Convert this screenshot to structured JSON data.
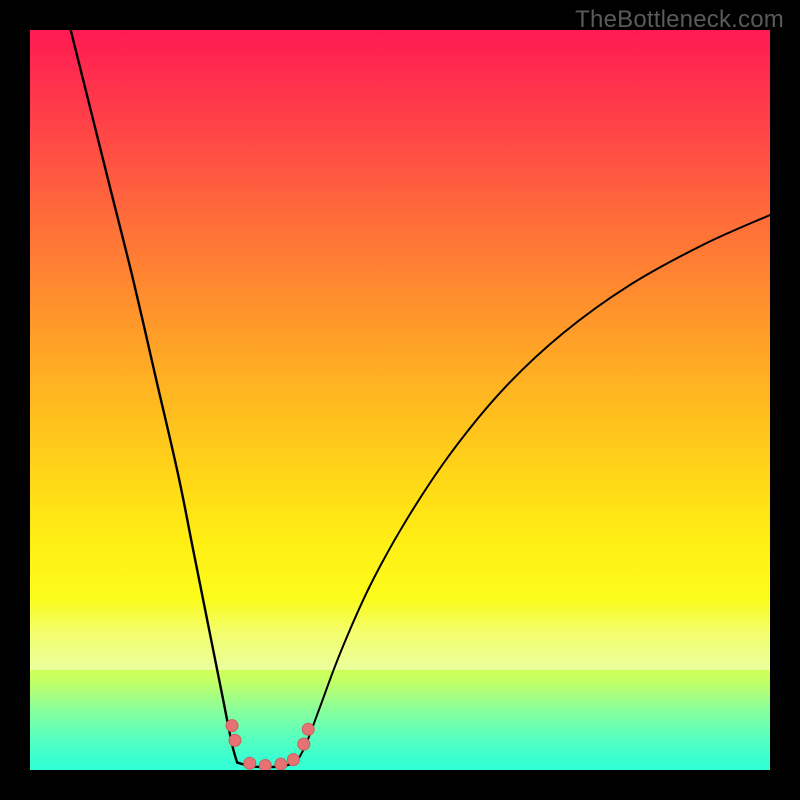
{
  "watermark": {
    "text": "TheBottleneck.com"
  },
  "colors": {
    "curve": "#000000",
    "marker_fill": "#e57373",
    "marker_stroke": "#cf5d5d",
    "frame": "#000000"
  },
  "chart_data": {
    "type": "line",
    "title": "",
    "xlabel": "",
    "ylabel": "",
    "ylim": [
      0,
      100
    ],
    "xlim": [
      0,
      100
    ],
    "note": "Axes are unlabeled in the source; x is a hardware-match parameter and y is bottleneck percentage (0 at bottom/green, 100 at top/red). Values below are read off the rendered curve in percent of each axis.",
    "series": [
      {
        "name": "left-branch",
        "x": [
          5.0,
          8.0,
          11.0,
          14.0,
          17.0,
          20.0,
          22.0,
          24.0,
          26.0,
          27.3,
          28.0
        ],
        "y": [
          102.0,
          90.0,
          78.0,
          66.0,
          53.0,
          40.0,
          30.0,
          20.0,
          10.0,
          3.5,
          1.0
        ]
      },
      {
        "name": "valley-floor",
        "x": [
          28.0,
          30.0,
          32.0,
          34.0,
          36.0
        ],
        "y": [
          1.0,
          0.5,
          0.4,
          0.5,
          1.0
        ]
      },
      {
        "name": "right-branch",
        "x": [
          36.0,
          37.3,
          39.0,
          42.0,
          46.0,
          51.0,
          57.0,
          64.0,
          72.0,
          81.0,
          91.0,
          100.0
        ],
        "y": [
          1.0,
          3.5,
          8.0,
          16.0,
          25.0,
          34.0,
          43.0,
          51.5,
          59.0,
          65.5,
          71.0,
          75.0
        ]
      }
    ],
    "markers": [
      {
        "x": 27.3,
        "y": 6.0,
        "r": 6
      },
      {
        "x": 27.7,
        "y": 4.0,
        "r": 6
      },
      {
        "x": 29.7,
        "y": 0.9,
        "r": 6
      },
      {
        "x": 31.8,
        "y": 0.6,
        "r": 6
      },
      {
        "x": 33.9,
        "y": 0.8,
        "r": 6
      },
      {
        "x": 35.6,
        "y": 1.4,
        "r": 6
      },
      {
        "x": 37.0,
        "y": 3.5,
        "r": 6
      },
      {
        "x": 37.6,
        "y": 5.5,
        "r": 6
      }
    ]
  }
}
